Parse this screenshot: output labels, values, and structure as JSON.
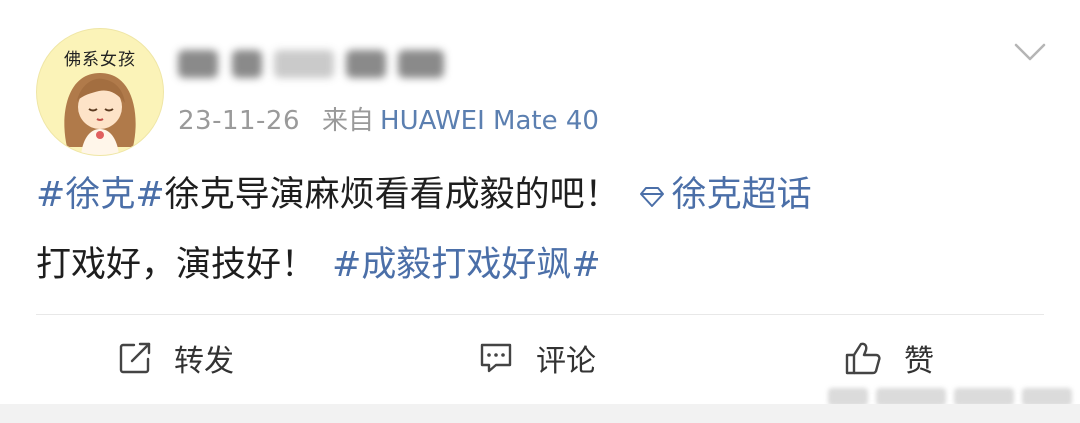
{
  "post": {
    "avatar_text": "佛系女孩",
    "meta": {
      "date": "23-11-26",
      "source_prefix": "来自",
      "device": "HUAWEI Mate 40"
    },
    "content": {
      "line1": {
        "topic": "#徐克#",
        "text": "徐克导演麻烦看看成毅的吧！",
        "super_topic": "徐克超话"
      },
      "line2": {
        "text": "打戏好，演技好！",
        "topic": "#成毅打戏好飒#"
      }
    },
    "actions": {
      "repost": "转发",
      "comment": "评论",
      "like": "赞"
    }
  },
  "colors": {
    "link": "#4b6fa8",
    "meta": "#9a9a9a",
    "avatar_bg": "#fbf3b8"
  },
  "icons": [
    "chevron-down-icon",
    "diamond-icon",
    "repost-icon",
    "comment-icon",
    "like-icon"
  ]
}
